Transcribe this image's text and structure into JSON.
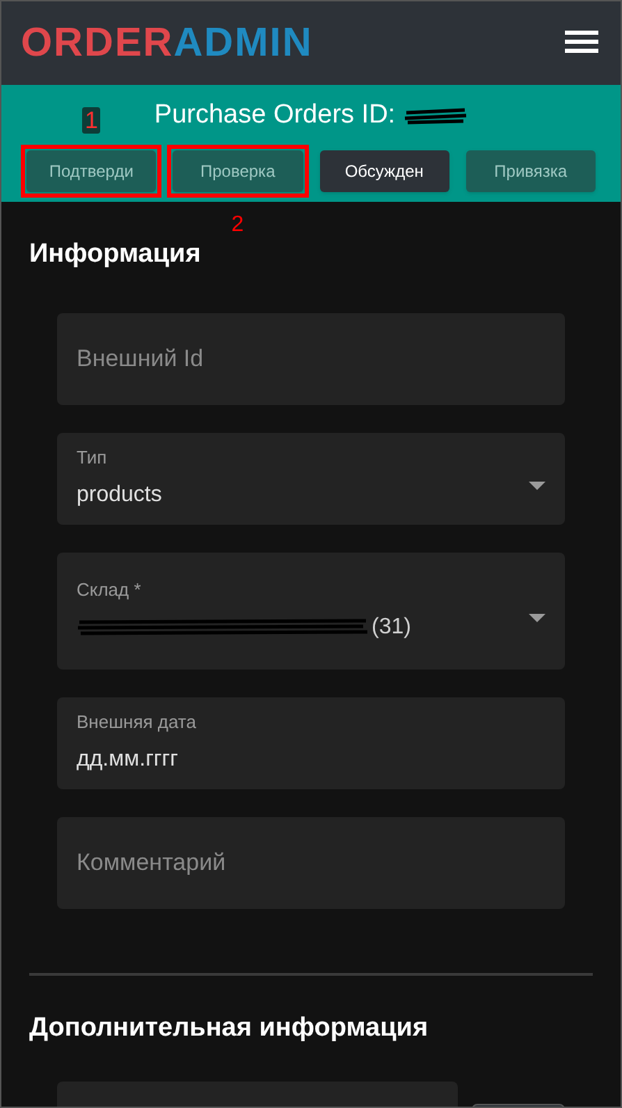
{
  "logo": {
    "part_1": "ORDER",
    "part_2": "ADMIN"
  },
  "title": "Purchase Orders ID:",
  "actions": [
    {
      "label": "Подтверди",
      "selected": false,
      "annotation": "1"
    },
    {
      "label": "Проверка",
      "selected": false,
      "annotation": "2"
    },
    {
      "label": "Обсужден",
      "selected": true
    },
    {
      "label": "Привязка",
      "selected": false
    }
  ],
  "sections": [
    {
      "heading": "Информация",
      "fields": [
        {
          "kind": "input",
          "placeholder": "Внешний Id"
        },
        {
          "kind": "select",
          "label": "Тип",
          "value": "products"
        },
        {
          "kind": "select",
          "label": "Склад *",
          "value": "(31)",
          "redacted": true
        },
        {
          "kind": "input",
          "label": "Внешняя дата",
          "value": "дд.мм.гггг"
        },
        {
          "kind": "input",
          "placeholder": "Комментарий"
        }
      ]
    },
    {
      "heading": "Дополнительная информация",
      "fields": [
        {
          "kind": "partial"
        }
      ]
    }
  ]
}
